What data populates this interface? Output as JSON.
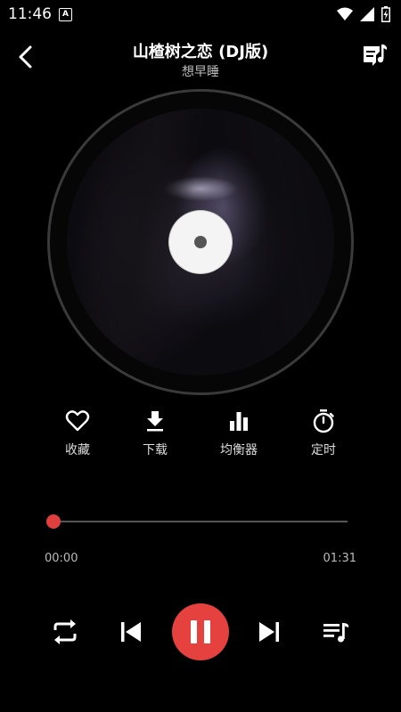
{
  "status_bar": {
    "time": "11:46",
    "notification_icon": "a-badge-icon",
    "notification_text": "A",
    "icons": [
      "wifi-icon",
      "signal-icon",
      "battery-charging-icon"
    ]
  },
  "header": {
    "back_icon": "chevron-left-icon",
    "title": "山楂树之恋 (DJ版)",
    "artist": "想早睡",
    "lyrics_icon": "lyrics-note-icon"
  },
  "disc": {
    "art_description": "album-cover-art"
  },
  "actions": [
    {
      "label": "收藏",
      "icon": "heart-icon"
    },
    {
      "label": "下载",
      "icon": "download-icon"
    },
    {
      "label": "均衡器",
      "icon": "equalizer-icon"
    },
    {
      "label": "定时",
      "icon": "timer-icon"
    }
  ],
  "progress": {
    "current": "00:00",
    "total": "01:31",
    "fraction": 0.0
  },
  "controls": {
    "repeat_icon": "repeat-icon",
    "prev_icon": "skip-previous-icon",
    "play_state_icon": "pause-icon",
    "next_icon": "skip-next-icon",
    "playlist_icon": "playlist-icon"
  },
  "colors": {
    "accent": "#e5413e",
    "background": "#000000",
    "text_primary": "#ffffff",
    "text_secondary": "#bbbbbb"
  }
}
